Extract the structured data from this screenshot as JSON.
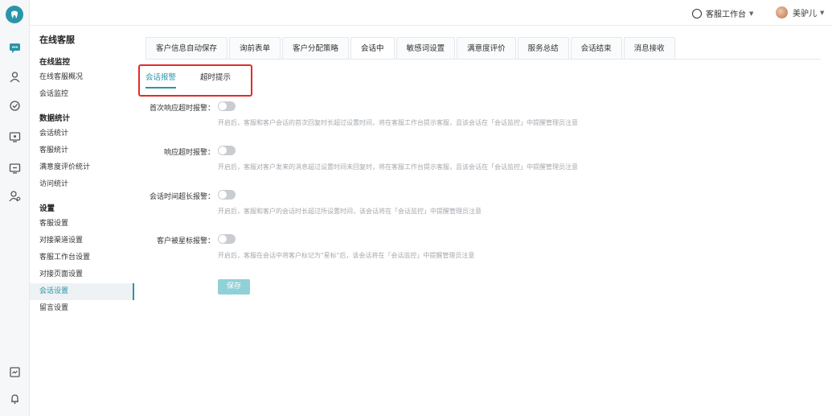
{
  "rail": {
    "icons": [
      "logo-icon",
      "chat-icon",
      "user-group-icon",
      "monitor-icon",
      "stats-icon",
      "display-icon",
      "contact-icon",
      "report-icon",
      "bell-icon"
    ]
  },
  "header": {
    "workspace_label": "客服工作台",
    "user_name": "美驴儿"
  },
  "subnav": {
    "app_title": "在线客服",
    "groups": [
      {
        "title": "在线监控",
        "items": [
          "在线客服概况",
          "会话监控"
        ]
      },
      {
        "title": "数据统计",
        "items": [
          "会话统计",
          "客服统计",
          "满意度评价统计",
          "访问统计"
        ]
      },
      {
        "title": "设置",
        "items": [
          "客服设置",
          "对接渠道设置",
          "客服工作台设置",
          "对接页面设置",
          "会话设置",
          "留言设置"
        ]
      }
    ],
    "active_item": "会话设置"
  },
  "tabs": [
    "客户信息自动保存",
    "询前表单",
    "客户分配策略",
    "会话中",
    "敏感词设置",
    "满意度评价",
    "服务总结",
    "会话结束",
    "消息接收"
  ],
  "active_tab": "会话中",
  "subtabs": [
    "会话报警",
    "超时提示"
  ],
  "active_subtab": "会话报警",
  "settings": [
    {
      "label": "首次响应超时报警：",
      "desc": "开启后，客服和客户会话的首次回复时长超过设置时间，将在客服工作台提示客服，且该会话在「会话监控」中提醒管理员注意"
    },
    {
      "label": "响应超时报警：",
      "desc": "开启后，客服对客户发来的消息超过设置时间未回复时，将在客服工作台提示客服，且该会话在「会话监控」中提醒管理员注意"
    },
    {
      "label": "会话时间超长报警：",
      "desc": "开启后，客服和客户的会话时长超过所设置时间，该会话将在「会话监控」中提醒管理员注意"
    },
    {
      "label": "客户被星标报警：",
      "desc": "开启后，客服在会话中将客户标记为\"星标\"后，该会话将在「会话监控」中提醒管理员注意"
    }
  ],
  "save_label": "保存",
  "colors": {
    "accent": "#2a95a8",
    "highlight": "#e22b2b",
    "save_disabled": "#8fd1d7"
  }
}
